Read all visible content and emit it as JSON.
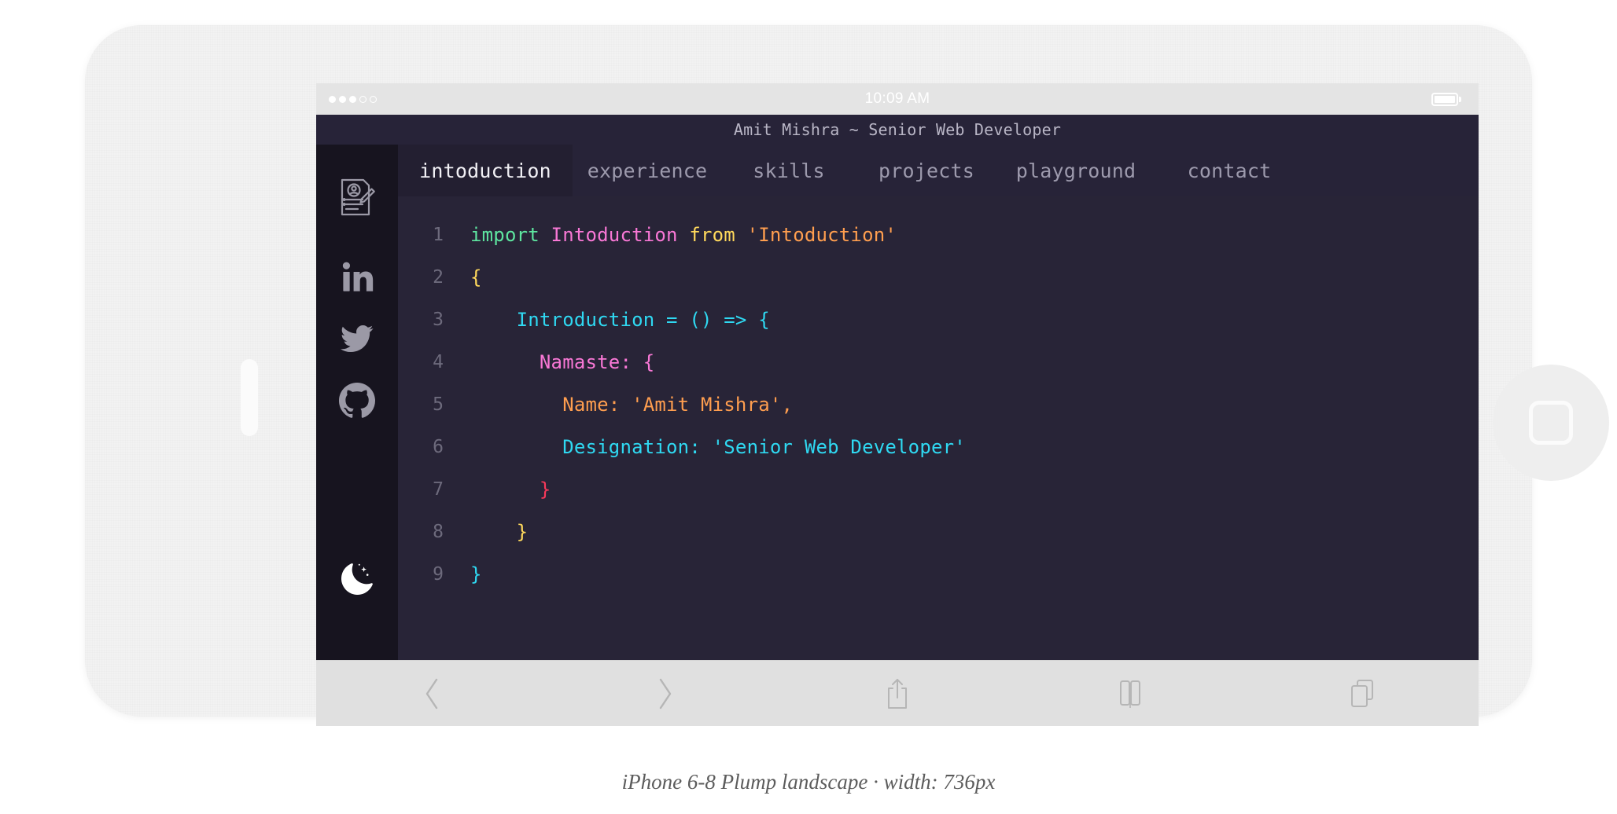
{
  "device": {
    "power_button": "power-button",
    "home_button": "home-button"
  },
  "status_bar": {
    "time": "10:09 AM",
    "signal_dots_filled": 3,
    "signal_dots_total": 5,
    "battery": "full"
  },
  "site": {
    "title": "Amit Mishra ~ Senior Web Developer"
  },
  "sidebar": {
    "items": [
      {
        "icon": "resume-icon",
        "label": "resume"
      },
      {
        "icon": "linkedin-icon",
        "label": "linkedin"
      },
      {
        "icon": "twitter-icon",
        "label": "twitter"
      },
      {
        "icon": "github-icon",
        "label": "github"
      },
      {
        "icon": "moon-icon",
        "label": "dark-mode-toggle"
      }
    ]
  },
  "tabs": [
    {
      "label": "intoduction",
      "active": true
    },
    {
      "label": "experience",
      "active": false
    },
    {
      "label": "skills",
      "active": false
    },
    {
      "label": "projects",
      "active": false
    },
    {
      "label": "playground",
      "active": false
    },
    {
      "label": "contact",
      "active": false
    }
  ],
  "editor": {
    "lines": [
      {
        "number": "1",
        "tokens": [
          {
            "text": "import ",
            "color": "#5ee6a0"
          },
          {
            "text": "Intoduction ",
            "color": "#f978d6"
          },
          {
            "text": "from ",
            "color": "#ffd95c"
          },
          {
            "text": "'Intoduction'",
            "color": "#ff9e4f"
          }
        ]
      },
      {
        "number": "2",
        "tokens": [
          {
            "text": "{",
            "color": "#ffd95c"
          }
        ]
      },
      {
        "number": "3",
        "tokens": [
          {
            "text": "    Introduction = () => {",
            "color": "#2fd9f2"
          }
        ]
      },
      {
        "number": "4",
        "tokens": [
          {
            "text": "      Namaste: {",
            "color": "#f978d6"
          }
        ]
      },
      {
        "number": "5",
        "tokens": [
          {
            "text": "        Name: 'Amit Mishra',",
            "color": "#ff9e4f"
          }
        ]
      },
      {
        "number": "6",
        "tokens": [
          {
            "text": "        Designation: 'Senior Web Developer'",
            "color": "#2fd9f2"
          }
        ]
      },
      {
        "number": "7",
        "tokens": [
          {
            "text": "      }",
            "color": "#f8395a"
          }
        ]
      },
      {
        "number": "8",
        "tokens": [
          {
            "text": "    }",
            "color": "#ffd95c"
          }
        ]
      },
      {
        "number": "9",
        "tokens": [
          {
            "text": "}",
            "color": "#2fd9f2"
          }
        ]
      }
    ]
  },
  "browser_toolbar": {
    "buttons": [
      {
        "icon": "back-chevron-icon",
        "label": "back"
      },
      {
        "icon": "forward-chevron-icon",
        "label": "forward"
      },
      {
        "icon": "share-icon",
        "label": "share"
      },
      {
        "icon": "bookmarks-icon",
        "label": "bookmarks"
      },
      {
        "icon": "tabs-icon",
        "label": "tabs"
      }
    ]
  },
  "caption": {
    "text": "iPhone 6-8 Plump landscape · width: 736px"
  },
  "colors": {
    "editor_bg": "#282437",
    "sidebar_bg": "#17141f",
    "tabbar_bg": "#272338",
    "active_tab_bg": "#231f31",
    "device_bg": "#f2f2f2",
    "chrome_bg": "#e0e0e0"
  }
}
